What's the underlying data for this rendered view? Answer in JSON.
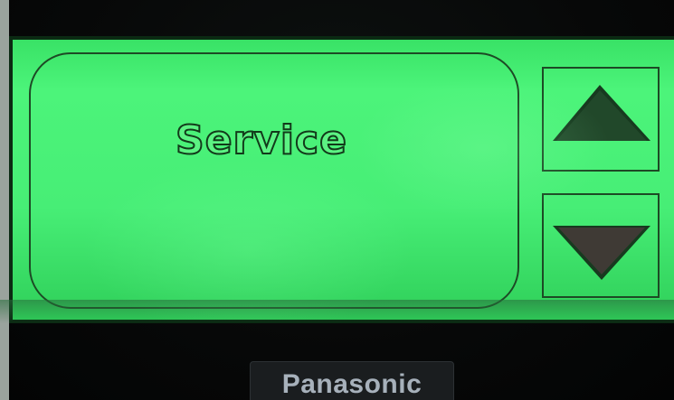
{
  "screen": {
    "title": "Service",
    "backlight_color": "#47ee76",
    "segment_color": "#123a1a"
  },
  "controls": {
    "scroll_up_icon": "triangle-up-icon",
    "scroll_down_icon": "triangle-down-icon"
  },
  "device": {
    "brand": "Panasonic"
  }
}
